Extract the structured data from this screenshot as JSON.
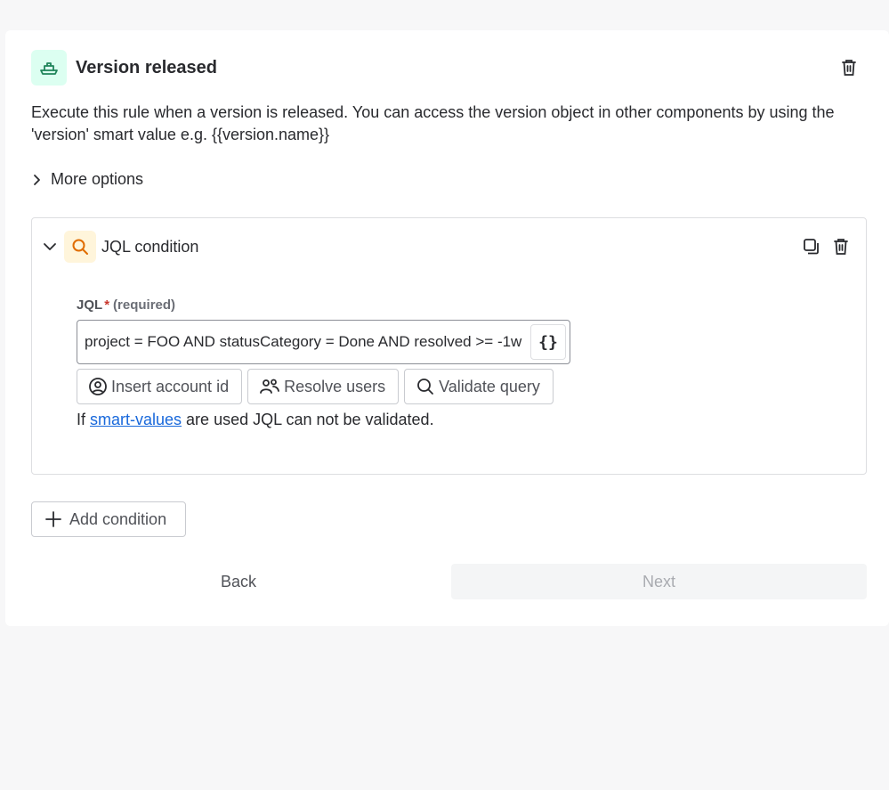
{
  "trigger": {
    "title": "Version released",
    "icon": "ship-icon",
    "description": "Execute this rule when a version is released. You can access the version object in other components by using the 'version' smart value e.g. {{version.name}}",
    "more_options": "More options"
  },
  "condition": {
    "title": "JQL condition",
    "icon": "search-icon",
    "field": {
      "label": "JQL",
      "required_mark": "*",
      "required_text": "(required)",
      "value": "project = FOO AND statusCategory = Done AND resolved >= -1w"
    },
    "smart_value_button": "{}",
    "actions": {
      "insert_account_id": "Insert account id",
      "resolve_users": "Resolve users",
      "validate_query": "Validate query"
    },
    "hint": {
      "prefix": "If ",
      "link": "smart-values",
      "suffix": " are used JQL can not be validated."
    }
  },
  "add_condition": "Add condition",
  "nav": {
    "back": "Back",
    "next": "Next"
  },
  "colors": {
    "trigger_icon_bg": "#dcfff1",
    "trigger_icon_fg": "#1f845a",
    "condition_icon_bg": "#fff5db",
    "condition_icon_fg": "#e06c00",
    "link": "#1868db",
    "required": "#c9372c"
  }
}
